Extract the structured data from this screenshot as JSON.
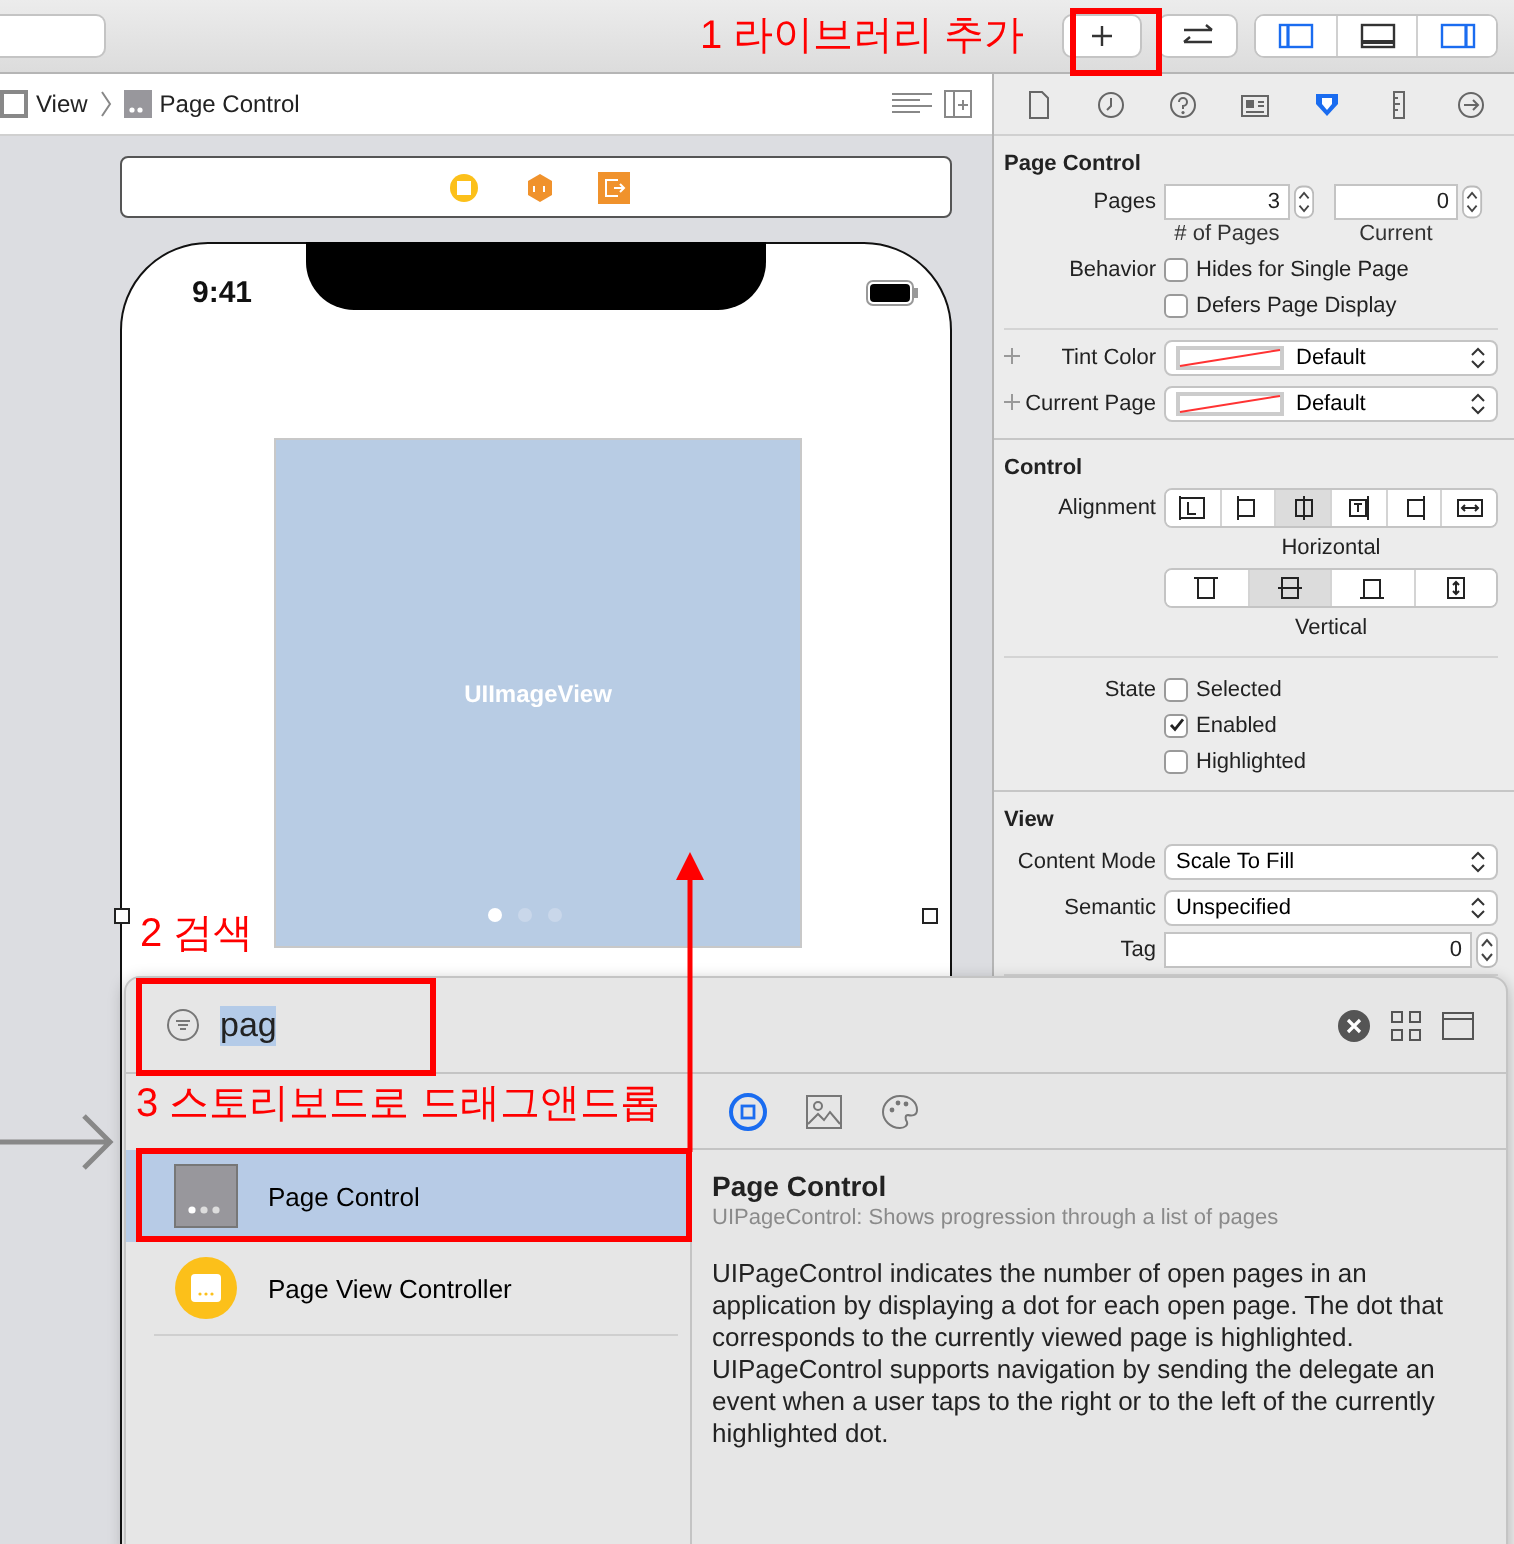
{
  "toolbar": {
    "panels": [
      {
        "kind": "left",
        "selected": true
      },
      {
        "kind": "bottom",
        "selected": false
      },
      {
        "kind": "right",
        "selected": true
      }
    ]
  },
  "annotations": [
    {
      "text": "1 라이브러리 추가"
    },
    {
      "text": "2 검색"
    },
    {
      "text": "3 스토리보드로 드래그앤드롭"
    }
  ],
  "breadcrumb": [
    {
      "label": "View",
      "kind": "view"
    },
    {
      "label": "Page Control",
      "kind": "page-control"
    }
  ],
  "inspector_tabs": [
    {
      "kind": "file",
      "selected": false
    },
    {
      "kind": "history",
      "selected": false
    },
    {
      "kind": "help",
      "selected": false
    },
    {
      "kind": "identity",
      "selected": false
    },
    {
      "kind": "attributes",
      "selected": true
    },
    {
      "kind": "size",
      "selected": false
    },
    {
      "kind": "connections",
      "selected": false
    }
  ],
  "canvas": {
    "time": "9:41",
    "image_view": "UIImageView",
    "page_dots": [
      {
        "selected": true
      },
      {
        "selected": false
      },
      {
        "selected": false
      }
    ]
  },
  "inspector": {
    "page_control": {
      "title": "Page Control",
      "pages_label": "Pages",
      "fields": [
        {
          "value": "3",
          "caption": "# of Pages"
        },
        {
          "value": "0",
          "caption": "Current"
        }
      ],
      "behavior_label": "Behavior",
      "behavior": [
        {
          "label": "Hides for Single Page",
          "checked": false
        },
        {
          "label": "Defers Page Display",
          "checked": false
        }
      ],
      "colors": [
        {
          "label": "Tint Color",
          "value": "Default"
        },
        {
          "label": "Current Page",
          "value": "Default"
        }
      ]
    },
    "control": {
      "title": "Control",
      "alignment_label": "Alignment",
      "horizontal": [
        {
          "kind": "left",
          "selected": false
        },
        {
          "kind": "left-edge",
          "selected": false
        },
        {
          "kind": "center",
          "selected": true
        },
        {
          "kind": "top",
          "selected": false
        },
        {
          "kind": "right-edge",
          "selected": false
        },
        {
          "kind": "fill",
          "selected": false
        }
      ],
      "horizontal_caption": "Horizontal",
      "vertical": [
        {
          "kind": "top",
          "selected": false
        },
        {
          "kind": "center",
          "selected": true
        },
        {
          "kind": "bottom",
          "selected": false
        },
        {
          "kind": "fill",
          "selected": false
        }
      ],
      "vertical_caption": "Vertical",
      "state_label": "State",
      "states": [
        {
          "label": "Selected",
          "checked": false
        },
        {
          "label": "Enabled",
          "checked": true
        },
        {
          "label": "Highlighted",
          "checked": false
        }
      ]
    },
    "view": {
      "title": "View",
      "content_mode_label": "Content Mode",
      "content_mode": "Scale To Fill",
      "semantic_label": "Semantic",
      "semantic": "Unspecified",
      "tag_label": "Tag",
      "tag": "0"
    }
  },
  "library": {
    "search": "pag",
    "tabs": [
      {
        "kind": "objects",
        "selected": true
      },
      {
        "kind": "media",
        "selected": false
      },
      {
        "kind": "colors",
        "selected": false
      }
    ],
    "items": [
      {
        "name": "Page Control",
        "kind": "page-control",
        "selected": true
      },
      {
        "name": "Page View Controller",
        "kind": "page-view-controller",
        "selected": false
      }
    ],
    "detail": {
      "title": "Page Control",
      "subtitle": "UIPageControl: Shows progression through a list of pages",
      "description": "UIPageControl indicates the number of open pages in an application by displaying a dot for each open page. The dot that corresponds to the currently viewed page is highlighted. UIPageControl supports navigation by sending the delegate an event when a user taps to the right or to the left of the currently highlighted dot."
    }
  }
}
